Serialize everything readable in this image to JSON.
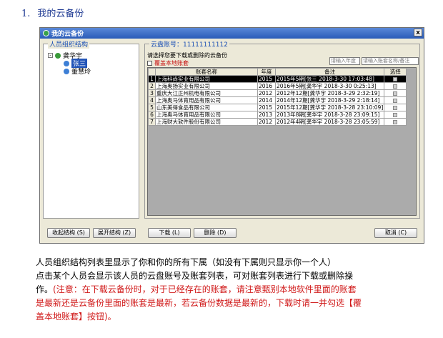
{
  "heading": {
    "number": "1.",
    "title": "我的云备份"
  },
  "window": {
    "title": "我的云备份",
    "close": "x",
    "left_group": "人员组织结构",
    "tree": {
      "root": "龚华宇",
      "children": [
        "张三",
        "董慧玲"
      ]
    },
    "right_group": "云盘账号：11111111112",
    "tip": "请选择您要下载或删除的云备份",
    "overwrite_label": "覆盖本地账套",
    "search_year_placeholder": "请输入年度",
    "search_name_placeholder": "请输入账套名称/备注",
    "table": {
      "headers": [
        "账套名称",
        "年度",
        "备注",
        "选择"
      ],
      "rows": [
        {
          "n": "1",
          "name": "上海科尚实业有限公司",
          "year": "2015",
          "note": "2015年5期[张三 2018-3-30 17:03:48]"
        },
        {
          "n": "2",
          "name": "上海奥扬实业有限公司",
          "year": "2016",
          "note": "2016年5期[龚华宇 2018-3-30 0:25:13]"
        },
        {
          "n": "3",
          "name": "重庆大江正州机电有限公司",
          "year": "2012",
          "note": "2012年12期[龚华宇 2018-3-29 2:32:19]"
        },
        {
          "n": "4",
          "name": "上海奥马体育用品有限公司",
          "year": "2014",
          "note": "2014年12期[龚华宇 2018-3-29 2:18:14]"
        },
        {
          "n": "5",
          "name": "山东美得食品有限公司",
          "year": "2015",
          "note": "2015年12期[龚华宇 2018-3-28 23:10:09]"
        },
        {
          "n": "6",
          "name": "上海奥马体育用品有限公司",
          "year": "2013",
          "note": "2013年8期[龚华宇 2018-3-28 23:09:15]"
        },
        {
          "n": "7",
          "name": "上海财大软件股份有限公司",
          "year": "2012",
          "note": "2012年4期[龚华宇 2018-3-28 23:05:59]"
        }
      ]
    },
    "buttons": {
      "collapse": "收起结构 (S)",
      "expand": "展开结构 (Z)",
      "download": "下载 (L)",
      "delete": "删除 (D)",
      "cancel": "取消 (C)"
    }
  },
  "paragraph": {
    "line1": "人员组织结构列表里显示了你和你的所有下属（如没有下属则只显示你一个人）",
    "line2": "点击某个人员会显示该人员的云盘账号及账套列表，可对账套列表进行下载或删除操",
    "line3_black": "作。",
    "line3_red": "(注意：在下载云备份时，对于已经存在的账套，请注意甄别本地软件里面的账套",
    "line4": "是最新还是云备份里面的账套是最新，若云备份数据是最新的，下载时请一并勾选【覆",
    "line5": "盖本地账套】按钮)。"
  }
}
